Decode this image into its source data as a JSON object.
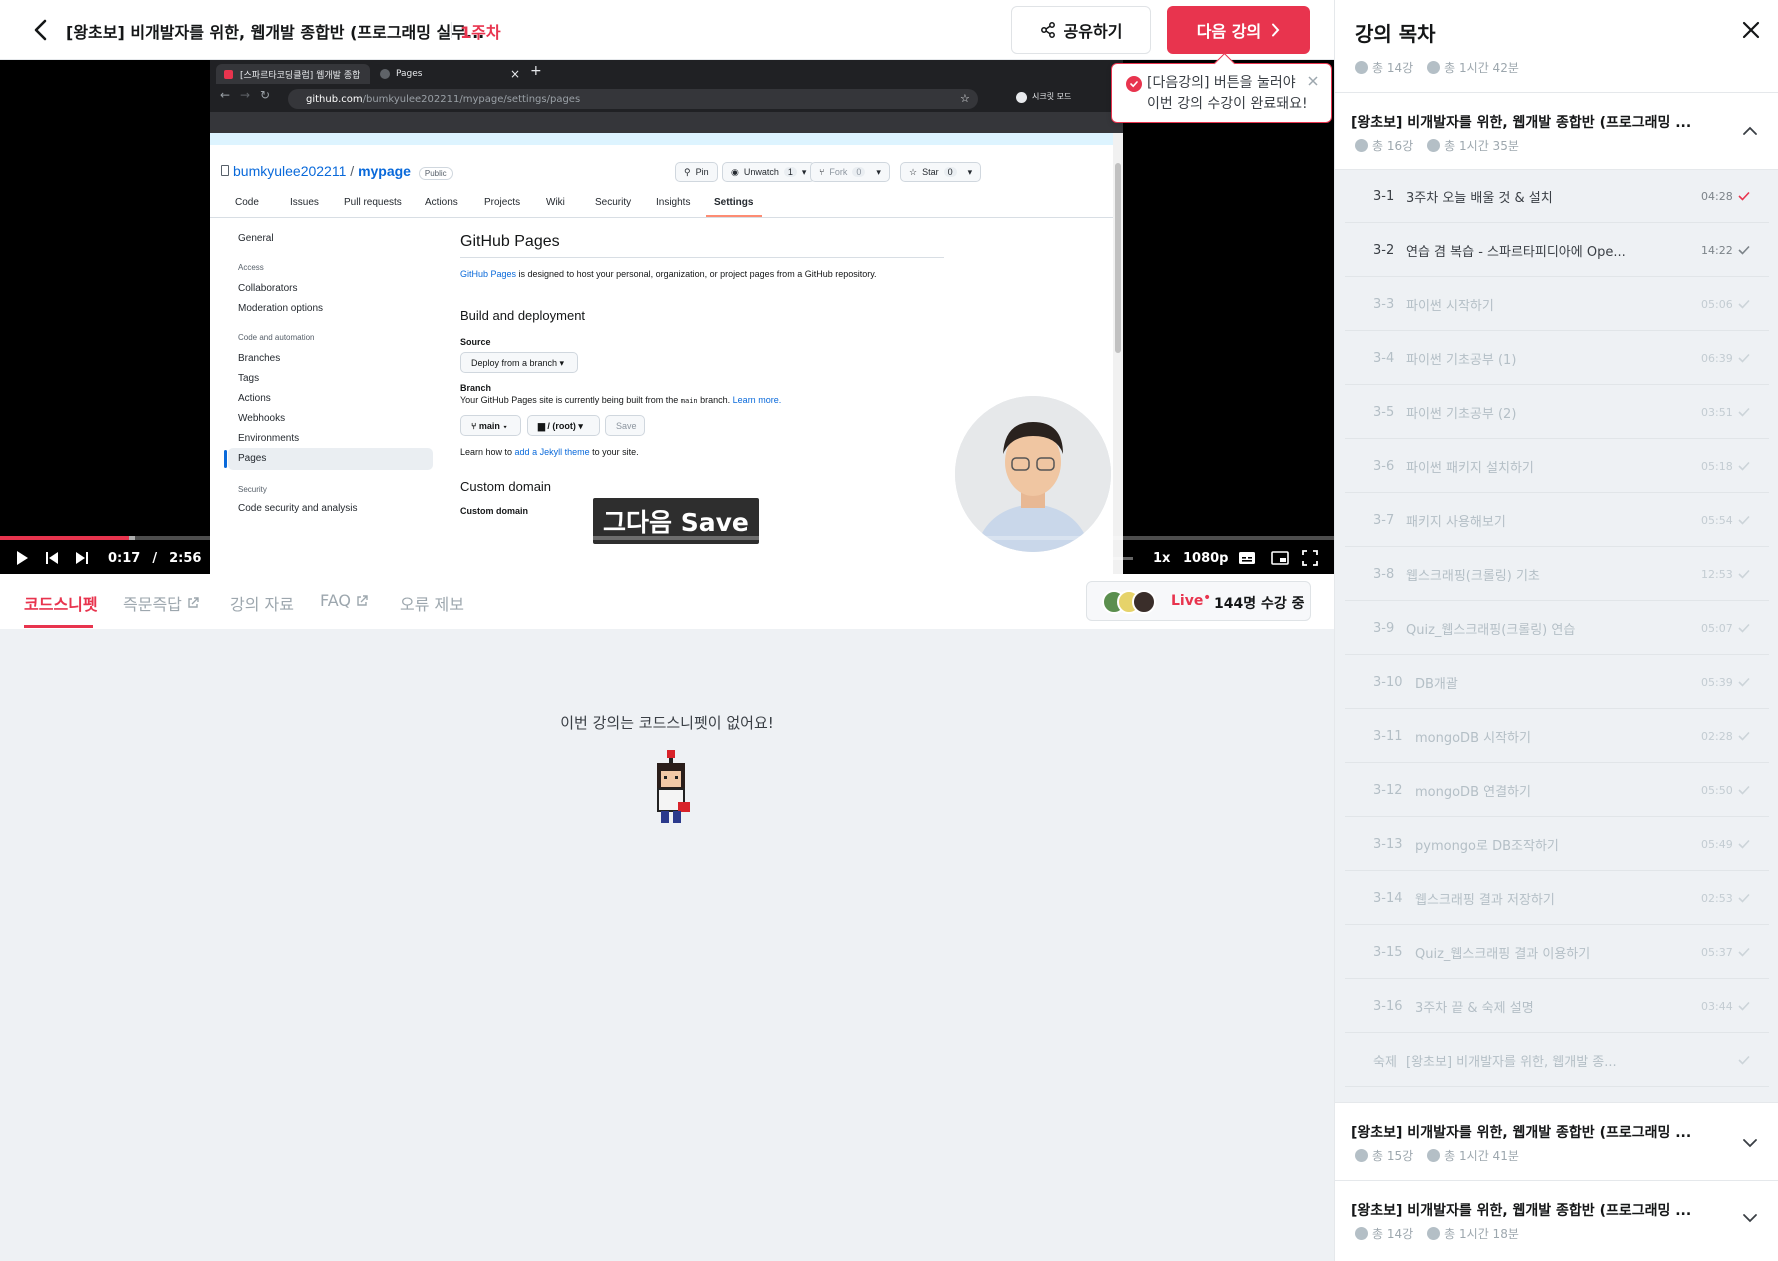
{
  "topbar": {
    "course_title": "[왕초보] 비개발자를 위한, 웹개발 종합반 (프로그래밍 실무...",
    "week": "1주차",
    "share_label": "공유하기",
    "next_label": "다음 강의"
  },
  "tooltip": {
    "text": "[다음강의] 버튼을 눌러야\n이번 강의 수강이 완료돼요!"
  },
  "video": {
    "browser": {
      "tab1": "[스파르타코딩클럽] 웹개발 종합...",
      "tab2": "Pages",
      "url_host": "github.com",
      "url_path": "/bumkyulee202211/mypage/settings/pages",
      "profile": "시크릿 모드"
    },
    "github": {
      "owner": "bumkyulee202211",
      "sep": "/",
      "repo": "mypage",
      "visibility": "Public",
      "pin": "Pin",
      "unwatch": "Unwatch",
      "unwatch_count": "1",
      "fork": "Fork",
      "fork_count": "0",
      "star": "Star",
      "star_count": "0",
      "nav": [
        "Code",
        "Issues",
        "Pull requests",
        "Actions",
        "Projects",
        "Wiki",
        "Security",
        "Insights",
        "Settings"
      ],
      "side_general": "General",
      "side_access": "Access",
      "side_collaborators": "Collaborators",
      "side_moderation": "Moderation options",
      "side_code_auto": "Code and automation",
      "side_branches": "Branches",
      "side_tags": "Tags",
      "side_actions": "Actions",
      "side_webhooks": "Webhooks",
      "side_environments": "Environments",
      "side_pages": "Pages",
      "side_security": "Security",
      "side_code_security": "Code security and analysis",
      "pages_title": "GitHub Pages",
      "pages_link": "GitHub Pages",
      "pages_desc": " is designed to host your personal, organization, or project pages from a GitHub repository.",
      "build_title": "Build and deployment",
      "source_label": "Source",
      "source_value": "Deploy from a branch",
      "branch_label": "Branch",
      "branch_desc": "Your GitHub Pages site is currently being built from the ",
      "branch_code": "main",
      "branch_desc2": " branch. ",
      "learn_more": "Learn more.",
      "branch_btn": "main",
      "folder_btn": "/ (root)",
      "save_btn": "Save",
      "jekyll_pre": "Learn how to ",
      "jekyll_link": "add a Jekyll theme",
      "jekyll_post": " to your site.",
      "custom_domain_title": "Custom domain",
      "custom_domain_label": "Custom domain"
    },
    "caption": "그다음 Save",
    "time_current": "0:17",
    "time_sep": "/",
    "time_total": "2:56",
    "speed": "1x",
    "quality": "1080p",
    "progress": 0.097,
    "buffered": 0.101
  },
  "tabs": [
    {
      "label": "코드스니펫"
    },
    {
      "label": "즉문즉답"
    },
    {
      "label": "강의 자료"
    },
    {
      "label": "FAQ"
    },
    {
      "label": "오류 제보"
    }
  ],
  "live": {
    "label": "Live",
    "dot": "•",
    "count": "144명 수강 중"
  },
  "empty_message": "이번 강의는 코드스니펫이 없어요!",
  "sidebar": {
    "title": "강의 목차",
    "prev_meta": {
      "lessons": "총 14강",
      "time": "총 1시간 42분"
    },
    "current_section": {
      "title": "[왕초보] 비개발자를 위한, 웹개발 종합반 (프로그래밍 ...",
      "lessons": "총 16강",
      "time": "총 1시간 35분"
    },
    "lessons": [
      {
        "num": "3-1",
        "title": "3주차 오늘 배울 것 & 설치",
        "duration": "04:28"
      },
      {
        "num": "3-2",
        "title": "연습 겸 복습 - 스파르타피디아에 Ope...",
        "duration": "14:22"
      },
      {
        "num": "3-3",
        "title": "파이썬 시작하기",
        "duration": "05:06"
      },
      {
        "num": "3-4",
        "title": "파이썬 기초공부 (1)",
        "duration": "06:39"
      },
      {
        "num": "3-5",
        "title": "파이썬 기초공부 (2)",
        "duration": "03:51"
      },
      {
        "num": "3-6",
        "title": "파이썬 패키지 설치하기",
        "duration": "05:18"
      },
      {
        "num": "3-7",
        "title": "패키지 사용해보기",
        "duration": "05:54"
      },
      {
        "num": "3-8",
        "title": "웹스크래핑(크롤링) 기초",
        "duration": "12:53"
      },
      {
        "num": "3-9",
        "title": "Quiz_웹스크래핑(크롤링) 연습",
        "duration": "05:07"
      },
      {
        "num": "3-10",
        "title": "DB개괄",
        "duration": "05:39"
      },
      {
        "num": "3-11",
        "title": "mongoDB 시작하기",
        "duration": "02:28"
      },
      {
        "num": "3-12",
        "title": "mongoDB 연결하기",
        "duration": "05:50"
      },
      {
        "num": "3-13",
        "title": "pymongo로 DB조작하기",
        "duration": "05:49"
      },
      {
        "num": "3-14",
        "title": "웹스크래핑 결과 저장하기",
        "duration": "02:53"
      },
      {
        "num": "3-15",
        "title": "Quiz_웹스크래핑 결과 이용하기",
        "duration": "05:37"
      },
      {
        "num": "3-16",
        "title": "3주차 끝 & 숙제 설명",
        "duration": "03:44"
      },
      {
        "num": "숙제",
        "title": "[왕초보] 비개발자를 위한, 웹개발 종...",
        "duration": ""
      }
    ],
    "next_sections": [
      {
        "title": "[왕초보] 비개발자를 위한, 웹개발 종합반 (프로그래밍 ...",
        "lessons": "총 15강",
        "time": "총 1시간 41분"
      },
      {
        "title": "[왕초보] 비개발자를 위한, 웹개발 종합반 (프로그래밍 ...",
        "lessons": "총 14강",
        "time": "총 1시간 18분"
      }
    ]
  },
  "colors": {
    "accent": "#e8344e",
    "bg_panel": "#eef1f4",
    "github_link": "#0969da"
  }
}
